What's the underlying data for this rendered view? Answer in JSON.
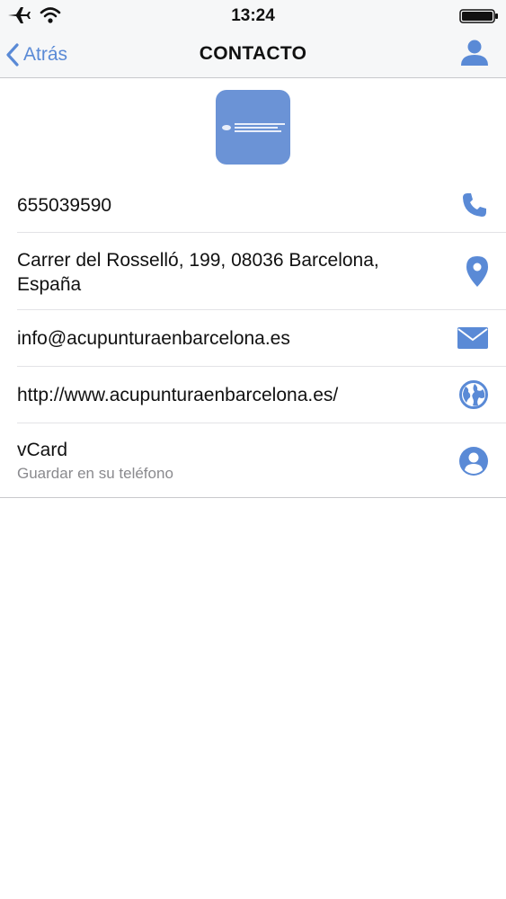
{
  "status_bar": {
    "time": "13:24"
  },
  "nav": {
    "back_label": "Atrás",
    "title": "CONTACTO"
  },
  "contact": {
    "phone": "655039590",
    "address": "Carrer del Rosselló, 199, 08036 Barcelona, España",
    "email": "info@acupunturaenbarcelona.es",
    "website": "http://www.acupunturaenbarcelona.es/",
    "vcard_label": "vCard",
    "vcard_subtitle": "Guardar en su teléfono"
  },
  "icons": {
    "phone": "phone-icon",
    "address": "map-pin-icon",
    "email": "envelope-icon",
    "website": "globe-icon",
    "vcard": "user-circle-icon"
  },
  "colors": {
    "accent": "#5a8ad6",
    "logo_background": "#6b93d6",
    "nav_background": "#f6f7f8",
    "subtitle_text": "#8a8a8e"
  }
}
